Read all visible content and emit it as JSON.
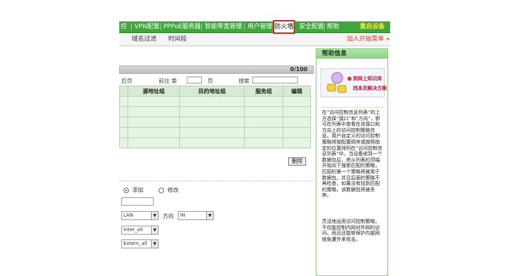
{
  "top_nav": {
    "items": [
      "控",
      "VPN配置",
      "PPPoE服务器",
      "智能带宽管理",
      "用户管理",
      "防火墙",
      "安全配置",
      "帮助"
    ],
    "active": "防火墙",
    "restart_label": "重启设备"
  },
  "sub_nav": {
    "items": [
      "域名过滤",
      "时间段"
    ],
    "add_menu_label": "加入开始菜单 »"
  },
  "list": {
    "count": "0/100",
    "pager": {
      "last_label": "后页",
      "goto_label": "前往 第",
      "page_unit": "页",
      "search_label": "搜索"
    },
    "columns": [
      "",
      "源地址组",
      "目的地址组",
      "服务组",
      "编辑"
    ],
    "rows": [
      [
        "",
        "",
        "",
        "",
        ""
      ],
      [
        "",
        "",
        "",
        "",
        ""
      ],
      [
        "",
        "",
        "",
        "",
        ""
      ],
      [
        "",
        "",
        "",
        "",
        ""
      ],
      [
        "",
        "",
        "",
        "",
        ""
      ]
    ],
    "delete_label": "删除"
  },
  "form": {
    "mode_add_label": "添加",
    "mode_edit_label": "修改",
    "mode_selected": "添加",
    "interface_value": "LAN",
    "direction_label": "方向",
    "direction_value": "IN",
    "src_group_value": "Inter_all",
    "dst_group_value": "Extern_all"
  },
  "help": {
    "title": "帮助信息",
    "banner_line1": "到网上知识库",
    "banner_line2": "找本页解决方案",
    "para1": "在“访问控制信息列表”的上方选择“接口”和“方向”，即可在列表中查看在该接口和方向上的访问控制策略信息。用户自定义的访问控制策略将按配置顺序或按照指定的位置排列在“访问控制信息列表”中，当设备收到一个数据包后，将从列表的顶端开始向下搜索匹配的策略，匹配的第一个策略将被用于数据包，并且后面的策略不再检查，如果没有找到匹配的策略，该数据包将被丢弃。",
    "para2": "灵活地运用访问控制策略，不仅能控制内网对外网的访问，而且还能够保护内部网络免遭外来攻击。"
  },
  "colors": {
    "nav_green": "#3fa63a",
    "active_border": "#e02020",
    "restart_yellow": "#f8e24a"
  }
}
